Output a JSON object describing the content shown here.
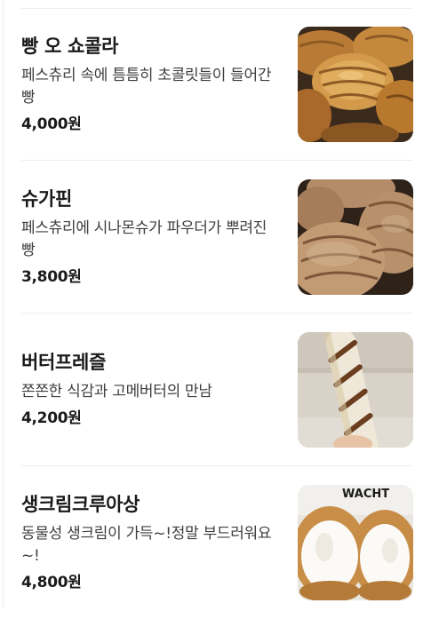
{
  "menu": {
    "items": [
      {
        "name": "빵 오 쇼콜라",
        "description": "페스츄리 속에 틈틈히 초콜릿들이 들어간 빵",
        "price": "4,000원",
        "photo_icon": "pain-au-chocolat-photo"
      },
      {
        "name": "슈가핀",
        "description": "페스츄리에 시나몬슈가 파우더가 뿌려진 빵",
        "price": "3,800원",
        "photo_icon": "sugar-pin-photo"
      },
      {
        "name": "버터프레즐",
        "description": "쫀쫀한 식감과 고메버터의 만남",
        "price": "4,200원",
        "photo_icon": "butter-pretzel-photo"
      },
      {
        "name": "생크림크루아상",
        "description": "동물성 생크림이 가득~!정말 부드러워요~!",
        "price": "4,800원",
        "photo_icon": "cream-croissant-photo",
        "photo_text": "WACHT"
      }
    ]
  }
}
